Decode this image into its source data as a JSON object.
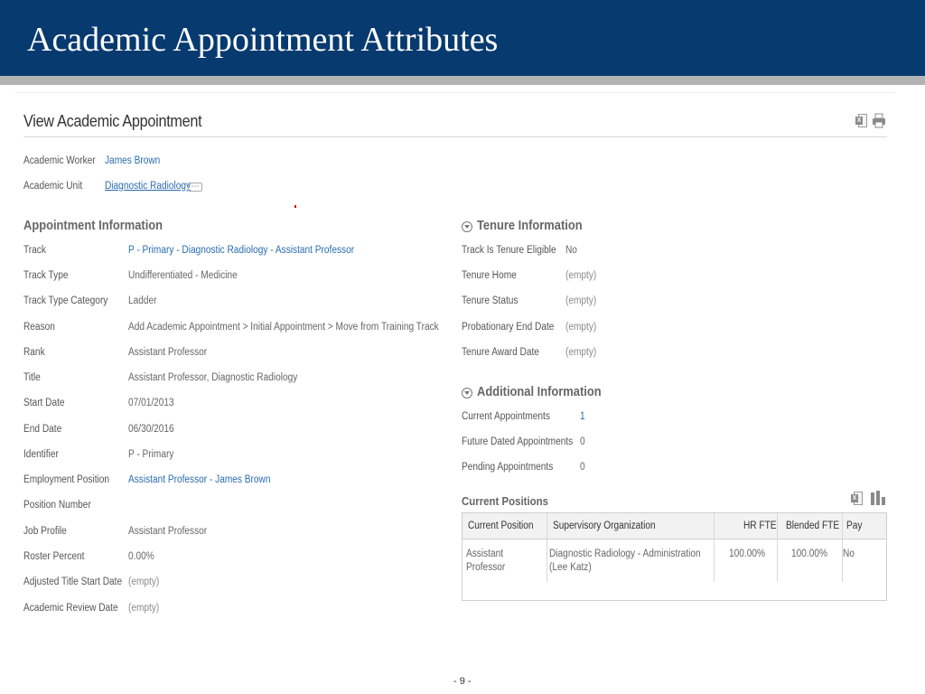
{
  "banner": {
    "title": "Academic Appointment Attributes"
  },
  "view": {
    "title": "View Academic Appointment",
    "excel_icon": "excel-export-icon",
    "print_icon": "print-icon"
  },
  "header_fields": {
    "worker_label": "Academic Worker",
    "worker_value": "James Brown",
    "unit_label": "Academic Unit",
    "unit_value": "Diagnostic Radiology",
    "related_actions": "⋯"
  },
  "appointment": {
    "title": "Appointment Information",
    "rows": [
      {
        "label": "Track",
        "value": "P - Primary - Diagnostic Radiology - Assistant Professor"
      },
      {
        "label": "Track Type",
        "value": "Undifferentiated - Medicine"
      },
      {
        "label": "Track Type Category",
        "value": "Ladder"
      },
      {
        "label": "Reason",
        "value": "Add Academic Appointment > Initial Appointment > Move from Training Track"
      },
      {
        "label": "Rank",
        "value": "Assistant Professor"
      },
      {
        "label": "Title",
        "value": "Assistant Professor, Diagnostic Radiology"
      },
      {
        "label": "Start Date",
        "value": "07/01/2013"
      },
      {
        "label": "End Date",
        "value": "06/30/2016"
      },
      {
        "label": "Identifier",
        "value": "P - Primary"
      },
      {
        "label": "Employment Position",
        "value": "Assistant Professor - James Brown"
      },
      {
        "label": "Position Number",
        "value": ""
      },
      {
        "label": "Job Profile",
        "value": "Assistant Professor"
      },
      {
        "label": "Roster Percent",
        "value": "0.00%"
      },
      {
        "label": "Adjusted Title Start Date",
        "value": "(empty)"
      },
      {
        "label": "Academic Review Date",
        "value": "(empty)"
      }
    ]
  },
  "tenure": {
    "title": "Tenure Information",
    "rows": [
      {
        "label": "Track Is Tenure Eligible",
        "value": "No"
      },
      {
        "label": "Tenure Home",
        "value": "(empty)"
      },
      {
        "label": "Tenure Status",
        "value": "(empty)"
      },
      {
        "label": "Probationary End Date",
        "value": "(empty)"
      },
      {
        "label": "Tenure Award Date",
        "value": "(empty)"
      }
    ]
  },
  "additional": {
    "title": "Additional Information",
    "rows": [
      {
        "label": "Current Appointments",
        "value": "1"
      },
      {
        "label": "Future Dated Appointments",
        "value": "0"
      },
      {
        "label": "Pending Appointments",
        "value": "0"
      }
    ]
  },
  "positions": {
    "title": "Current Positions",
    "headers": [
      "Current Position",
      "Supervisory Organization",
      "HR FTE",
      "Blended FTE",
      "Pay"
    ],
    "row": {
      "position_line1": "Assistant",
      "position_line2": "Professor",
      "org_line1": "Diagnostic Radiology - Administration",
      "org_line2": "(Lee Katz)",
      "hr_fte": "100.00%",
      "blended_fte": "100.00%",
      "pay": "No"
    }
  },
  "footer": {
    "page": "- 9 -"
  },
  "colors": {
    "banner": "#073a6f",
    "link": "#2a6cb0",
    "strip": "#b3b3b3"
  }
}
